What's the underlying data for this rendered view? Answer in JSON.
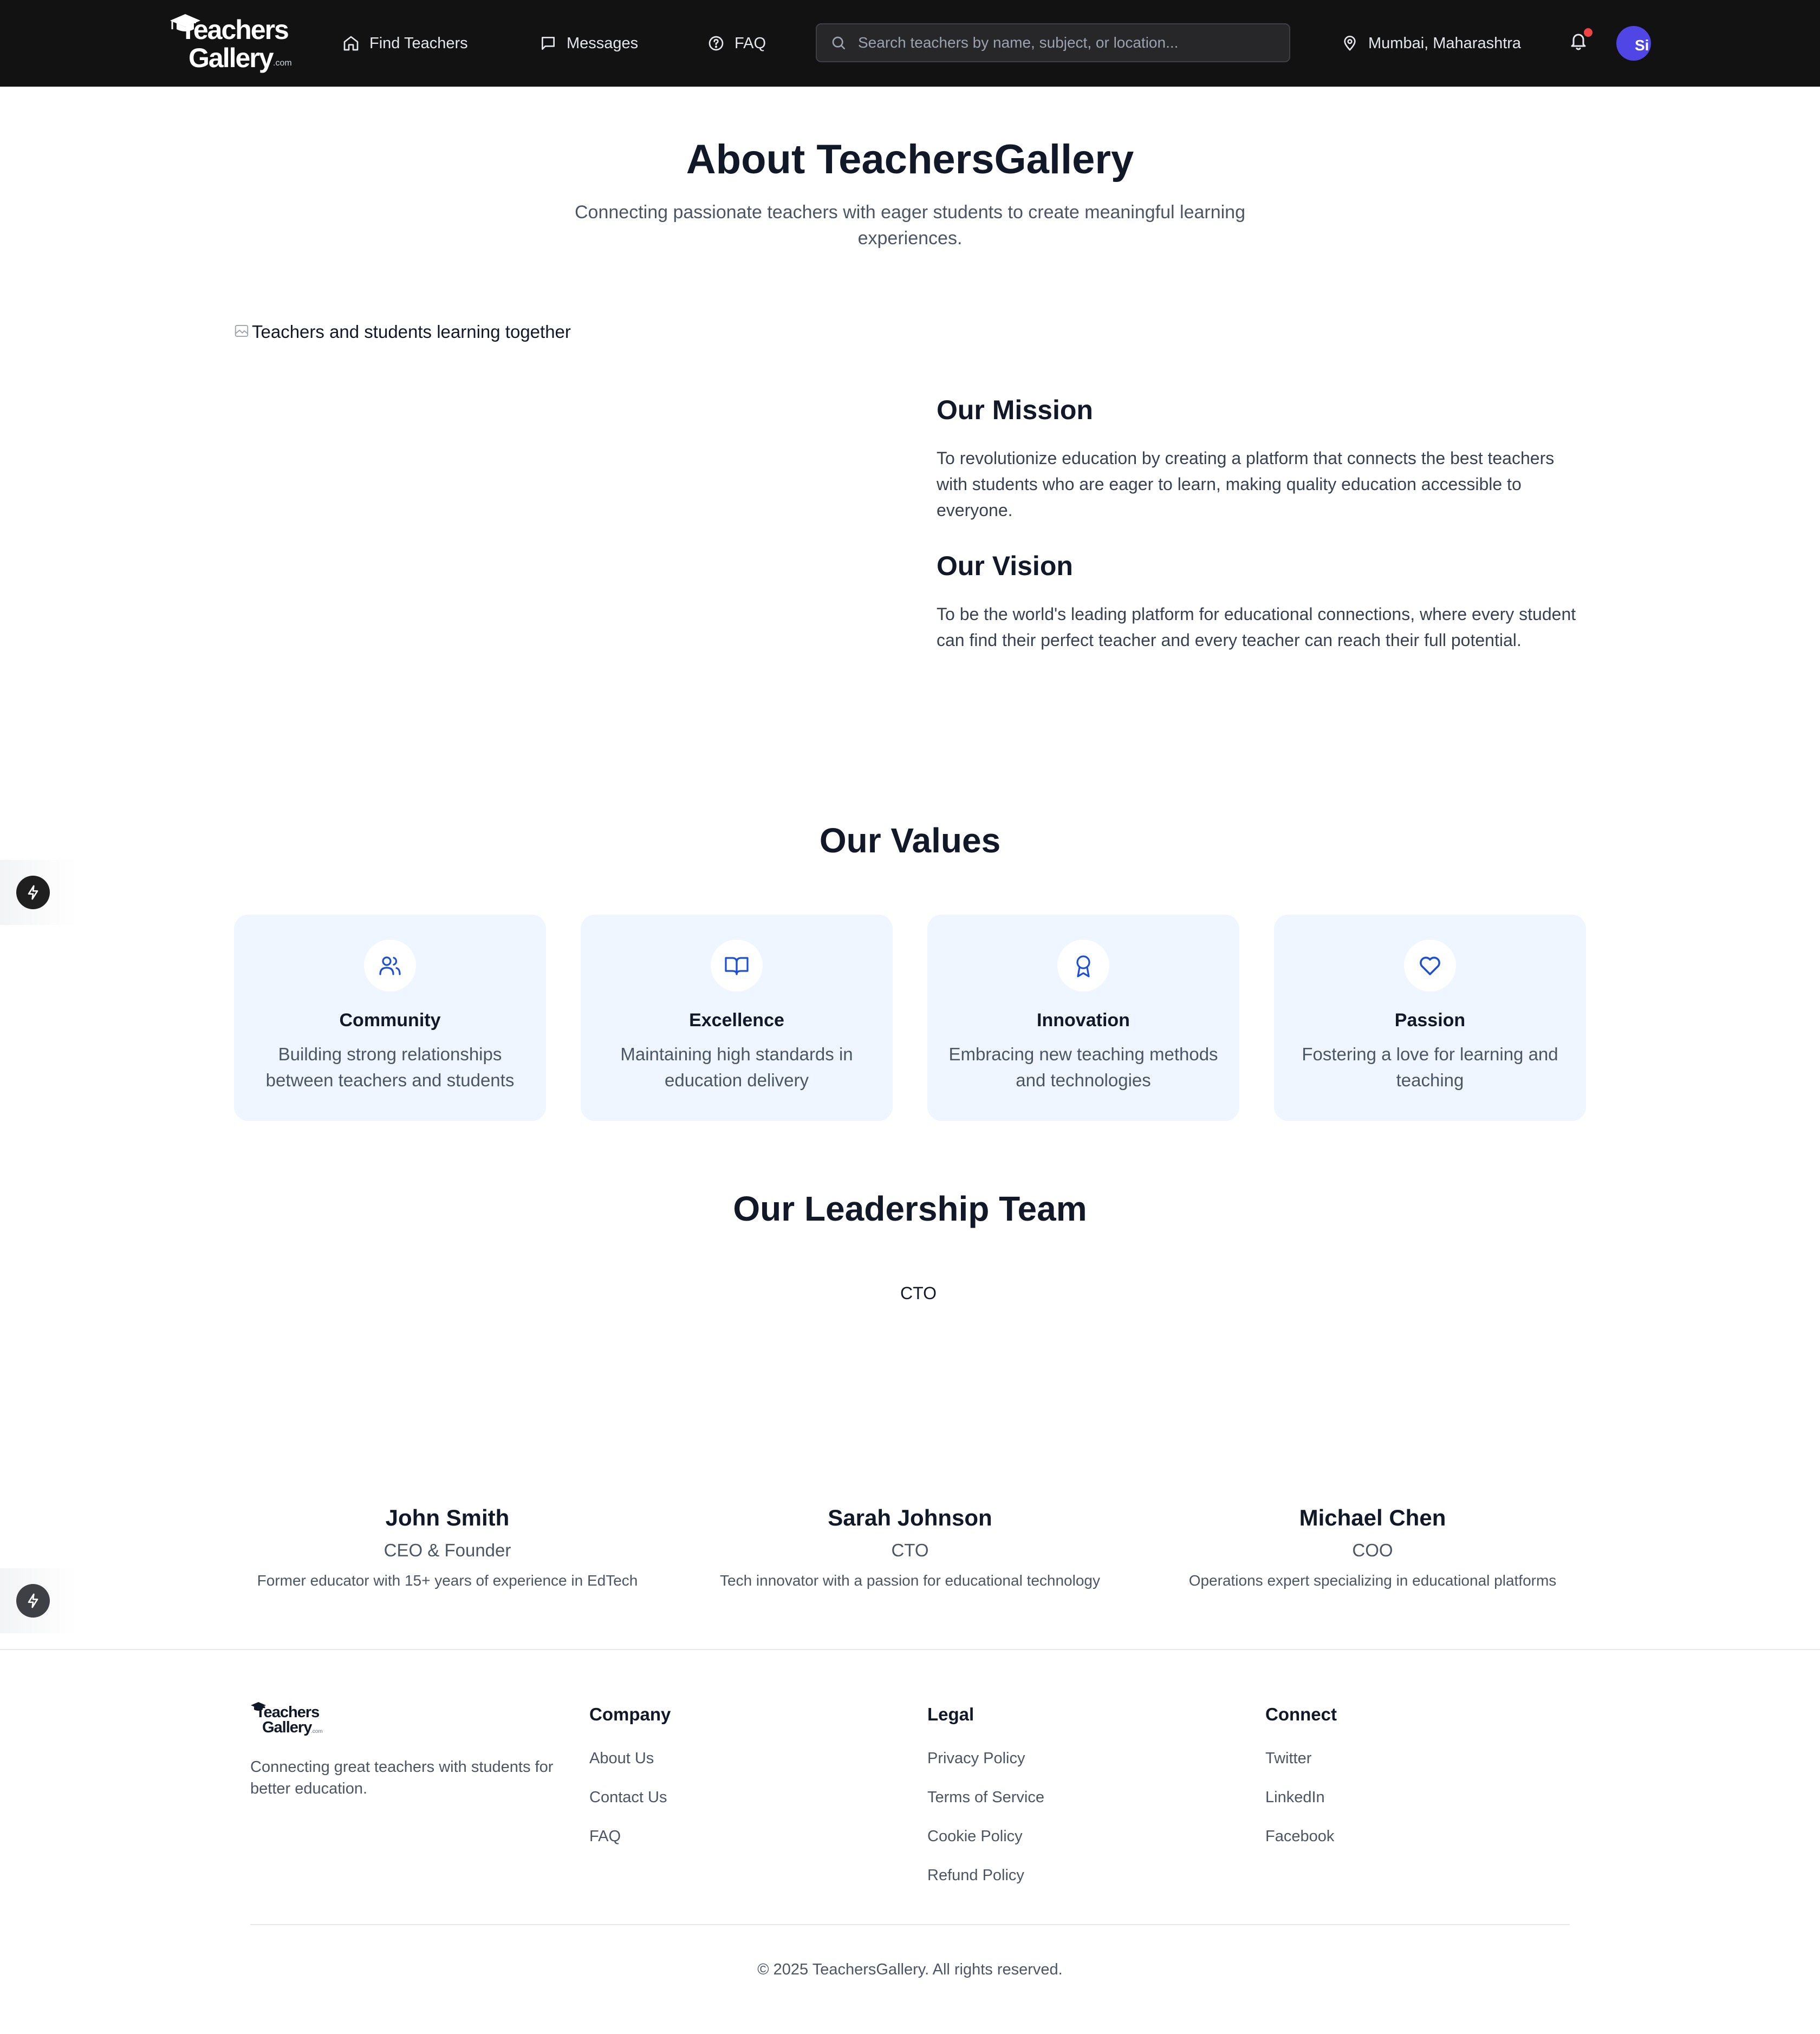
{
  "header": {
    "logo_line1": "Teachers",
    "logo_line2": "Gallery",
    "logo_suffix": ".com",
    "nav": [
      {
        "label": "Find Teachers",
        "icon": "home-icon"
      },
      {
        "label": "Messages",
        "icon": "message-icon"
      },
      {
        "label": "FAQ",
        "icon": "help-circle-icon"
      }
    ],
    "search_placeholder": "Search teachers by name, subject, or location...",
    "location": "Mumbai, Maharashtra",
    "avatar_text": "Si",
    "notification_dot_color": "#ef4444",
    "avatar_color": "#4f46e5"
  },
  "about": {
    "title": "About TeachersGallery",
    "subtitle_line1": "Connecting passionate teachers with eager students to create meaningful learning",
    "subtitle_line2": "experiences.",
    "image_alt": "Teachers and students learning together",
    "mission_title": "Our Mission",
    "mission_text": "To revolutionize education by creating a platform that connects the best teachers with students who are eager to learn, making quality education accessible to everyone.",
    "vision_title": "Our Vision",
    "vision_text": "To be the world's leading platform for educational connections, where every student can find their perfect teacher and every teacher can reach their full potential."
  },
  "values": {
    "title": "Our Values",
    "items": [
      {
        "title": "Community",
        "desc": "Building strong relationships between teachers and students",
        "icon": "users-icon"
      },
      {
        "title": "Excellence",
        "desc": "Maintaining high standards in education delivery",
        "icon": "book-open-icon"
      },
      {
        "title": "Innovation",
        "desc": "Embracing new teaching methods and technologies",
        "icon": "award-icon"
      },
      {
        "title": "Passion",
        "desc": "Fostering a love for learning and teaching",
        "icon": "heart-icon"
      }
    ],
    "accent_color": "#1d4ed8",
    "card_bg": "#eff6ff"
  },
  "team": {
    "title": "Our Leadership Team",
    "image_alt_text": "CTO",
    "members": [
      {
        "name": "John Smith",
        "role": "CEO & Founder",
        "bio": "Former educator with 15+ years of experience in EdTech"
      },
      {
        "name": "Sarah Johnson",
        "role": "CTO",
        "bio": "Tech innovator with a passion for educational technology"
      },
      {
        "name": "Michael Chen",
        "role": "COO",
        "bio": "Operations expert specializing in educational platforms"
      }
    ]
  },
  "footer": {
    "logo_line1": "Teachers",
    "logo_line2": "Gallery",
    "logo_suffix": ".com",
    "tagline": "Connecting great teachers with students for better education.",
    "company": {
      "title": "Company",
      "links": [
        "About Us",
        "Contact Us",
        "FAQ"
      ]
    },
    "legal": {
      "title": "Legal",
      "links": [
        "Privacy Policy",
        "Terms of Service",
        "Cookie Policy",
        "Refund Policy"
      ]
    },
    "connect": {
      "title": "Connect",
      "links": [
        "Twitter",
        "LinkedIn",
        "Facebook"
      ]
    },
    "copyright": "© 2025 TeachersGallery. All rights reserved."
  }
}
